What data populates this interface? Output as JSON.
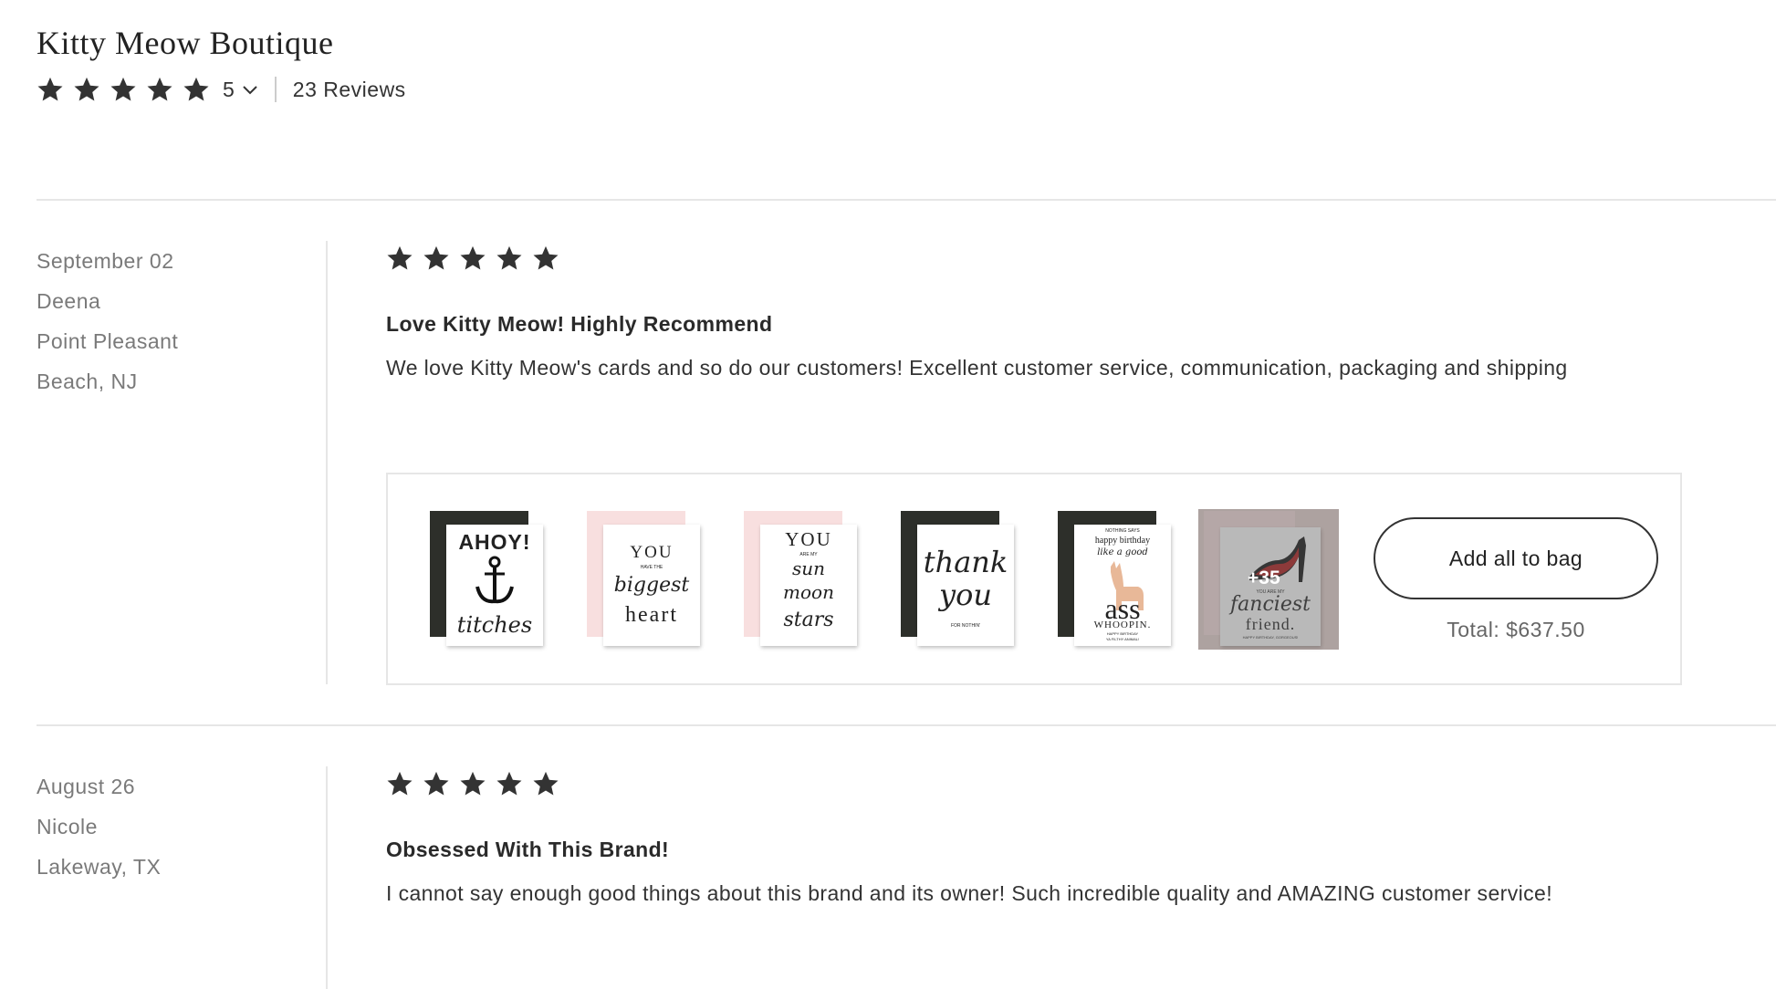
{
  "shop": {
    "name": "Kitty Meow Boutique",
    "rating": "5",
    "star_count": 5,
    "review_count": "23 Reviews"
  },
  "reviews": [
    {
      "date": "September 02",
      "name": "Deena",
      "location_line1": "Point Pleasant",
      "location_line2": "Beach, NJ",
      "stars": 5,
      "title": "Love Kitty Meow! Highly Recommend",
      "text": "We love Kitty Meow's cards and so do our customers! Excellent customer service, communication, packaging and shipping",
      "products": {
        "cards": [
          {
            "name": "ahoy-card",
            "lines": [
              "AHOY!",
              "titches"
            ]
          },
          {
            "name": "biggest-heart-card",
            "lines": [
              "YOU",
              "HAVE THE",
              "biggest",
              "heart"
            ]
          },
          {
            "name": "sun-moon-stars-card",
            "lines": [
              "YOU",
              "ARE MY",
              "sun",
              "moon",
              "stars"
            ]
          },
          {
            "name": "thank-you-card",
            "lines": [
              "thank",
              "you",
              "FOR NOTHIN'"
            ]
          },
          {
            "name": "birthday-card",
            "lines": [
              "NOTHING SAYS",
              "happy birthday",
              "like a good",
              "ass",
              "WHOOPIN.",
              "HAPPY BIRTHDAY",
              "YA FILTHY ANIMAL!"
            ]
          },
          {
            "name": "fanciest-friend-card",
            "lines": [
              "YOU ARE MY",
              "fanciest",
              "friend.",
              "HAPPY BIRTHDAY, GORGEOUS!"
            ]
          }
        ],
        "more_label": "+35",
        "add_button": "Add all to bag",
        "total": "Total: $637.50"
      }
    },
    {
      "date": "August 26",
      "name": "Nicole",
      "location_line1": "Lakeway, TX",
      "stars": 5,
      "title": "Obsessed With This Brand!",
      "text": "I cannot say enough good things about this brand and its owner! Such incredible quality and AMAZING customer service!"
    }
  ],
  "colors": {
    "text": "#333333",
    "muted": "#7a7a7a",
    "divider": "#e6e6e6",
    "star": "#333333"
  },
  "icons": {
    "star": "star-icon",
    "chevron": "chevron-down-icon"
  }
}
